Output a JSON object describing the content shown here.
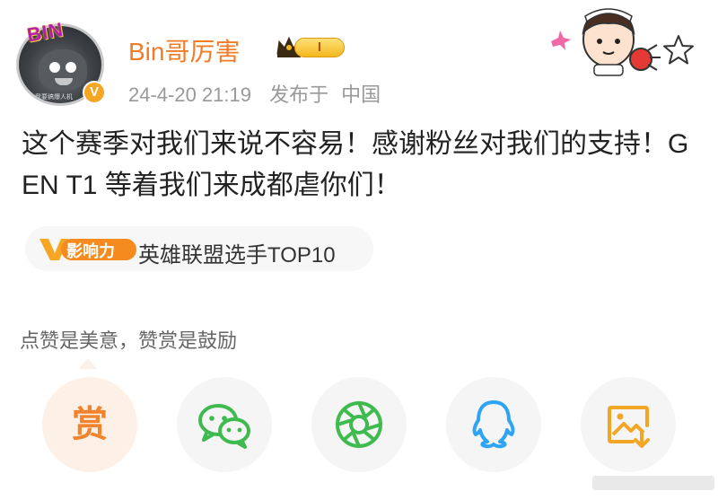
{
  "post": {
    "username": "Bin哥厉害",
    "vip_level": "I",
    "avatar_tag": "BIN",
    "avatar_caption": "我要搞爆人机",
    "verified_mark": "V",
    "timestamp": "24-4-20 21:19",
    "location_prefix": "发布于",
    "location": "中国",
    "text": "这个赛季对我们来说不容易！感谢粉丝对我们的支持！GEN T1 等着我们来成都虐你们！"
  },
  "topic": {
    "badge_text": "影响力",
    "label": "英雄联盟选手TOP10"
  },
  "reward": {
    "tip": "点赞是美意，赞赏是鼓励",
    "reward_label": "赏"
  },
  "share_buttons": [
    {
      "name": "reward",
      "icon": "reward-icon"
    },
    {
      "name": "wechat",
      "icon": "wechat-icon",
      "color": "#3fba4f"
    },
    {
      "name": "moments",
      "icon": "moments-icon",
      "color": "#3fba4f"
    },
    {
      "name": "qq",
      "icon": "qq-icon",
      "color": "#2fa4f5"
    },
    {
      "name": "save-image",
      "icon": "save-image-icon",
      "color": "#f2a626"
    }
  ],
  "colors": {
    "accent": "#f07c28",
    "username": "#f07c28",
    "meta": "#999999",
    "green": "#3fba4f",
    "blue": "#2fa4f5",
    "gold": "#f2a626"
  }
}
